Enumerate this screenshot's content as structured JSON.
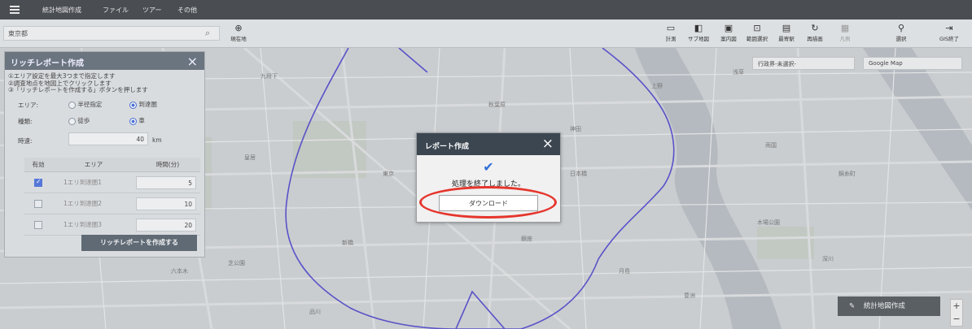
{
  "menubar": {
    "items": [
      "統計地図作成",
      "ファイル",
      "ツアー",
      "その他"
    ]
  },
  "toolbar": {
    "search_value": "東京都",
    "current_location_label": "現在地",
    "buttons": [
      "計測",
      "サブ地図",
      "案内図",
      "範囲選択",
      "最寄駅",
      "再描画",
      "凡例",
      "選択",
      "GIS終了"
    ]
  },
  "map": {
    "layer_select": "行政界-未選択-",
    "base_select": "Google Map",
    "zoom_plus": "+",
    "zoom_minus": "−",
    "stat_map_button": "統計地図作成",
    "labels": [
      "九段下",
      "上野",
      "浅草",
      "東京",
      "日本橋",
      "銀座",
      "新橋",
      "品川",
      "芝公園",
      "六本木",
      "豊洲",
      "月島",
      "木場公園",
      "深川",
      "錦糸町",
      "両国",
      "秋葉原",
      "神田",
      "皇居",
      "赤坂"
    ]
  },
  "rich_report_panel": {
    "title": "リッチレポート作成",
    "instructions": [
      "①エリア設定を最大3つまで指定します",
      "②調査地点を地図上でクリックします",
      "③「リッチレポートを作成する」ボタンを押します"
    ],
    "area_label": "エリア:",
    "area_options": [
      "半径指定",
      "到達圏"
    ],
    "type_label": "種類:",
    "type_options": [
      "徒歩",
      "車"
    ],
    "speed_label": "時速:",
    "speed_value": "40",
    "speed_unit": "km",
    "table_headers": [
      "有効",
      "エリア",
      "時間(分)"
    ],
    "rows": [
      {
        "area": "1エリ到達圏1",
        "minutes": "5",
        "enabled": true
      },
      {
        "area": "1エリ到達圏2",
        "minutes": "10",
        "enabled": false
      },
      {
        "area": "1エリ到達圏3",
        "minutes": "20",
        "enabled": false
      }
    ],
    "create_button": "リッチレポートを作成する"
  },
  "report_dialog": {
    "title": "レポート作成",
    "message": "処理を終了しました。",
    "download_button": "ダウンロード"
  },
  "colors": {
    "isochrone": "#5a52c8",
    "highlight_ring": "#e5362d",
    "check": "#2f6ed8"
  }
}
